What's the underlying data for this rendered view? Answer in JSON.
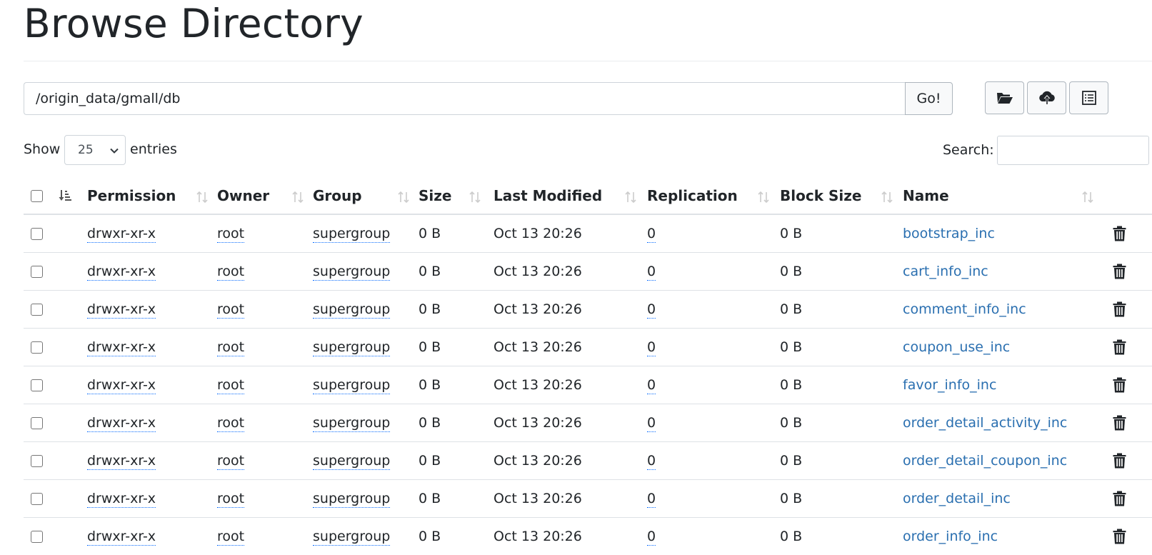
{
  "page": {
    "title": "Browse Directory"
  },
  "path_bar": {
    "value": "/origin_data/gmall/db",
    "go_label": "Go!"
  },
  "toolbar": {
    "buttons": [
      {
        "icon": "folder-open-icon"
      },
      {
        "icon": "cloud-upload-icon"
      },
      {
        "icon": "list-icon"
      }
    ]
  },
  "controls": {
    "show_label": "Show",
    "entries_label": "entries",
    "page_length": "25",
    "search_label": "Search:",
    "search_value": ""
  },
  "table": {
    "headers": {
      "permission": "Permission",
      "owner": "Owner",
      "group": "Group",
      "size": "Size",
      "last_modified": "Last Modified",
      "replication": "Replication",
      "block_size": "Block Size",
      "name": "Name"
    },
    "rows": [
      {
        "permission": "drwxr-xr-x",
        "owner": "root",
        "group": "supergroup",
        "size": "0 B",
        "last_modified": "Oct 13 20:26",
        "replication": "0",
        "block_size": "0 B",
        "name": "bootstrap_inc"
      },
      {
        "permission": "drwxr-xr-x",
        "owner": "root",
        "group": "supergroup",
        "size": "0 B",
        "last_modified": "Oct 13 20:26",
        "replication": "0",
        "block_size": "0 B",
        "name": "cart_info_inc"
      },
      {
        "permission": "drwxr-xr-x",
        "owner": "root",
        "group": "supergroup",
        "size": "0 B",
        "last_modified": "Oct 13 20:26",
        "replication": "0",
        "block_size": "0 B",
        "name": "comment_info_inc"
      },
      {
        "permission": "drwxr-xr-x",
        "owner": "root",
        "group": "supergroup",
        "size": "0 B",
        "last_modified": "Oct 13 20:26",
        "replication": "0",
        "block_size": "0 B",
        "name": "coupon_use_inc"
      },
      {
        "permission": "drwxr-xr-x",
        "owner": "root",
        "group": "supergroup",
        "size": "0 B",
        "last_modified": "Oct 13 20:26",
        "replication": "0",
        "block_size": "0 B",
        "name": "favor_info_inc"
      },
      {
        "permission": "drwxr-xr-x",
        "owner": "root",
        "group": "supergroup",
        "size": "0 B",
        "last_modified": "Oct 13 20:26",
        "replication": "0",
        "block_size": "0 B",
        "name": "order_detail_activity_inc"
      },
      {
        "permission": "drwxr-xr-x",
        "owner": "root",
        "group": "supergroup",
        "size": "0 B",
        "last_modified": "Oct 13 20:26",
        "replication": "0",
        "block_size": "0 B",
        "name": "order_detail_coupon_inc"
      },
      {
        "permission": "drwxr-xr-x",
        "owner": "root",
        "group": "supergroup",
        "size": "0 B",
        "last_modified": "Oct 13 20:26",
        "replication": "0",
        "block_size": "0 B",
        "name": "order_detail_inc"
      },
      {
        "permission": "drwxr-xr-x",
        "owner": "root",
        "group": "supergroup",
        "size": "0 B",
        "last_modified": "Oct 13 20:26",
        "replication": "0",
        "block_size": "0 B",
        "name": "order_info_inc"
      }
    ]
  },
  "colors": {
    "link": "#2a6fb0",
    "text": "#212529",
    "border": "#dee2e6",
    "abbr_underline": "#0d6efd"
  }
}
